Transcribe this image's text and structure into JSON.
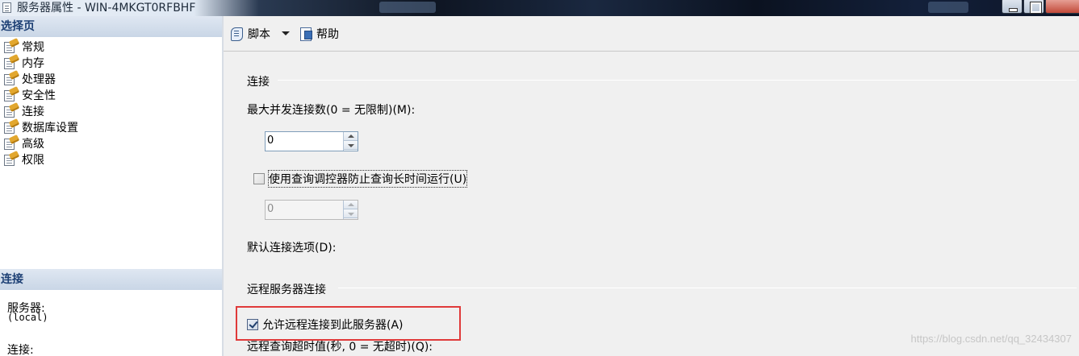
{
  "window": {
    "title": "服务器属性 - WIN-4MKGT0RFBHF"
  },
  "sidebar": {
    "header": "选择页",
    "items": [
      {
        "label": "常规",
        "icon": "page-wrench-icon"
      },
      {
        "label": "内存",
        "icon": "page-wrench-icon"
      },
      {
        "label": "处理器",
        "icon": "page-wrench-icon"
      },
      {
        "label": "安全性",
        "icon": "page-wrench-icon"
      },
      {
        "label": "连接",
        "icon": "page-wrench-icon",
        "selected": true
      },
      {
        "label": "数据库设置",
        "icon": "page-wrench-icon"
      },
      {
        "label": "高级",
        "icon": "page-wrench-icon"
      },
      {
        "label": "权限",
        "icon": "page-wrench-icon"
      }
    ]
  },
  "connection_panel": {
    "header": "连接",
    "server_label": "服务器:",
    "server_value": "(local)",
    "connection_label": "连接:"
  },
  "toolbar": {
    "script_label": "脚本",
    "help_label": "帮助"
  },
  "main": {
    "group_connections": "连接",
    "max_connections_label": "最大并发连接数(0 = 无限制)(M):",
    "max_connections_value": "0",
    "query_governor_label": "使用查询调控器防止查询长时间运行(U)",
    "query_governor_checked": false,
    "query_governor_value": "0",
    "default_options_label": "默认连接选项(D):",
    "group_remote": "远程服务器连接",
    "allow_remote_label": "允许远程连接到此服务器(A)",
    "allow_remote_checked": true,
    "remote_timeout_label": "远程查询超时值(秒, 0 = 无超时)(Q):"
  },
  "watermark": "https://blog.csdn.net/qq_32434307",
  "colors": {
    "highlight": "#e03a3a",
    "section_header_text": "#1c3f74"
  }
}
